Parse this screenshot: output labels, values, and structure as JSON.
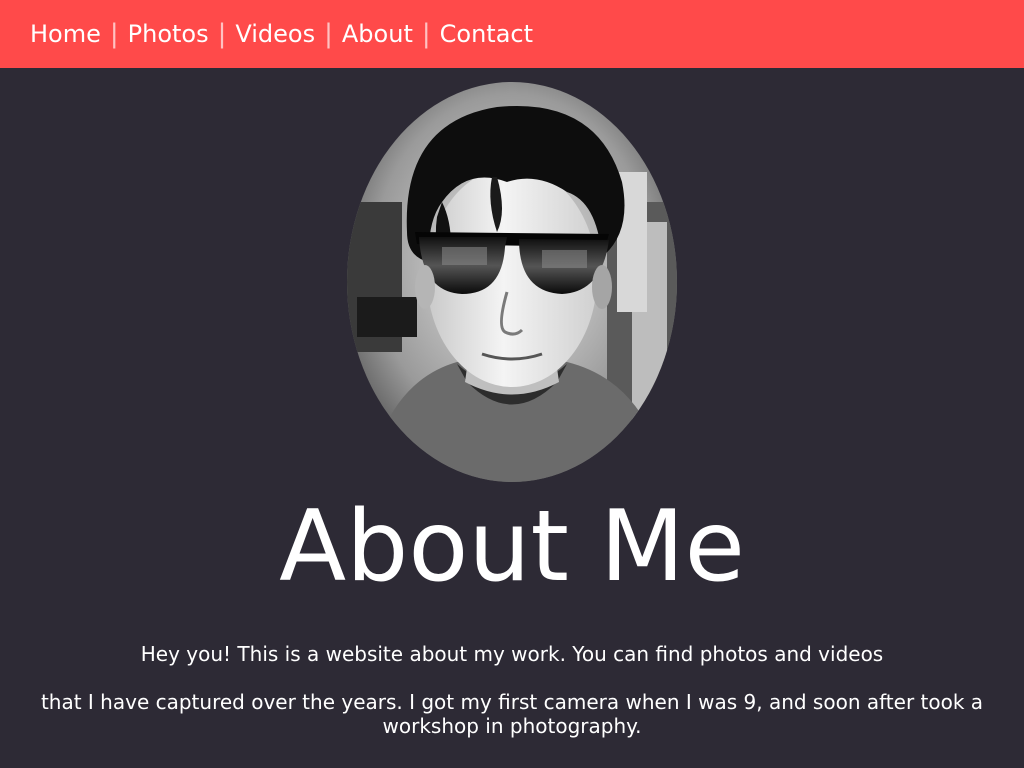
{
  "nav": {
    "items": [
      {
        "label": "Home"
      },
      {
        "label": "Photos"
      },
      {
        "label": "Videos"
      },
      {
        "label": "About"
      },
      {
        "label": "Contact"
      }
    ],
    "separator": "|",
    "color": "#ff4a4a"
  },
  "portrait": {
    "style": "black-and-white",
    "subject": "person wearing sunglasses"
  },
  "main": {
    "title": "About Me",
    "paragraphs": [
      "Hey you! This is a website about my work. You can find photos and videos",
      "that I have captured over the years. I got my first camera when I was 9, and soon after took a workshop in photography."
    ]
  },
  "colors": {
    "background": "#2d2a35",
    "navbar": "#ff4a4a",
    "text": "#ffffff"
  }
}
